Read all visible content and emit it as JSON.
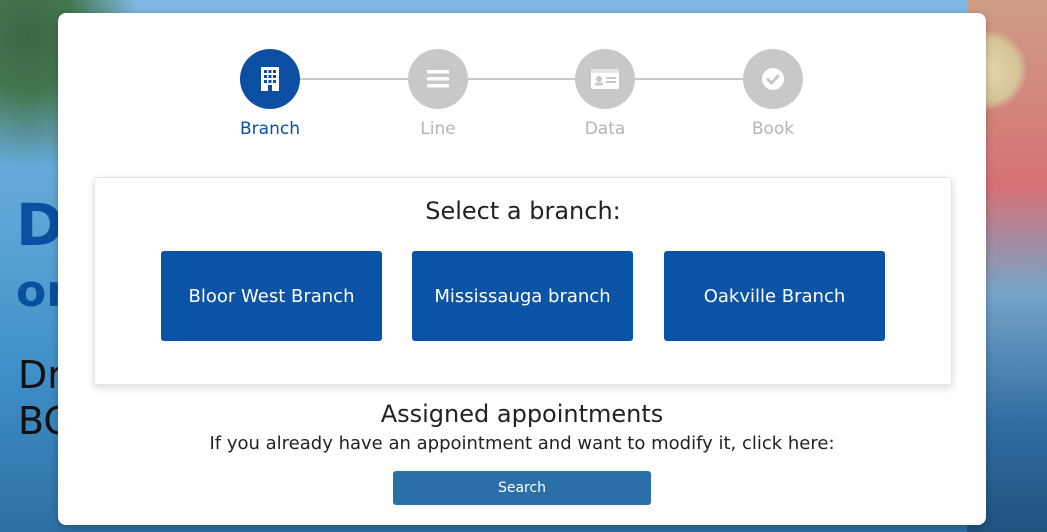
{
  "background": {
    "hero_line1": "De",
    "hero_line2": "on",
    "hero_line3": "Dr",
    "hero_line4": "BC"
  },
  "stepper": {
    "steps": [
      {
        "label": "Branch",
        "icon": "building-icon",
        "state": "active"
      },
      {
        "label": "Line",
        "icon": "list-icon",
        "state": "inactive"
      },
      {
        "label": "Data",
        "icon": "id-card-icon",
        "state": "inactive"
      },
      {
        "label": "Book",
        "icon": "check-circle-icon",
        "state": "inactive"
      }
    ],
    "active_color": "#0b4fa3",
    "inactive_color": "#c8c8c8"
  },
  "branch_panel": {
    "title": "Select a branch:",
    "branches": [
      {
        "label": "Bloor West Branch"
      },
      {
        "label": "Mississauga branch"
      },
      {
        "label": "Oakville Branch"
      }
    ],
    "button_color": "#0b53a7"
  },
  "assigned": {
    "title": "Assigned appointments",
    "subtitle": "If you already have an appointment and want to modify it, click here:",
    "search_label": "Search"
  }
}
